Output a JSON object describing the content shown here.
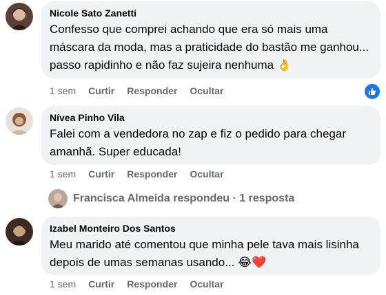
{
  "comments": [
    {
      "author": "Nicole Sato Zanetti",
      "text": "Confesso que comprei achando que era só mais uma máscara da moda, mas a praticidade do bastão me ganhou... passo rapidinho e não faz sujeira nenhuma",
      "emoji": "👌",
      "time": "1 sem",
      "like": "Curtir",
      "reply": "Responder",
      "hide": "Ocultar",
      "reaction_icon": "like-icon"
    },
    {
      "author": "Nívea Pinho Vila",
      "text": "Falei com a vendedora no zap e fiz o pedido para chegar amanhã. Super educada!",
      "time": "1 sem",
      "like": "Curtir",
      "reply": "Responder",
      "hide": "Ocultar"
    },
    {
      "author": "Izabel Monteiro Dos Santos",
      "text": "Meu marido até comentou que minha pele tava mais lisinha depois de umas semanas usando...",
      "emoji": "😂❤️",
      "time": "1 sem",
      "like": "Curtir",
      "reply": "Responder",
      "hide": "Ocultar"
    }
  ],
  "reply_thread": {
    "text": "Francisca Almeida respondeu · 1 resposta"
  },
  "colors": {
    "bubble": "#f0f2f5",
    "muted": "#65676b",
    "like_blue": "#1877f2"
  }
}
